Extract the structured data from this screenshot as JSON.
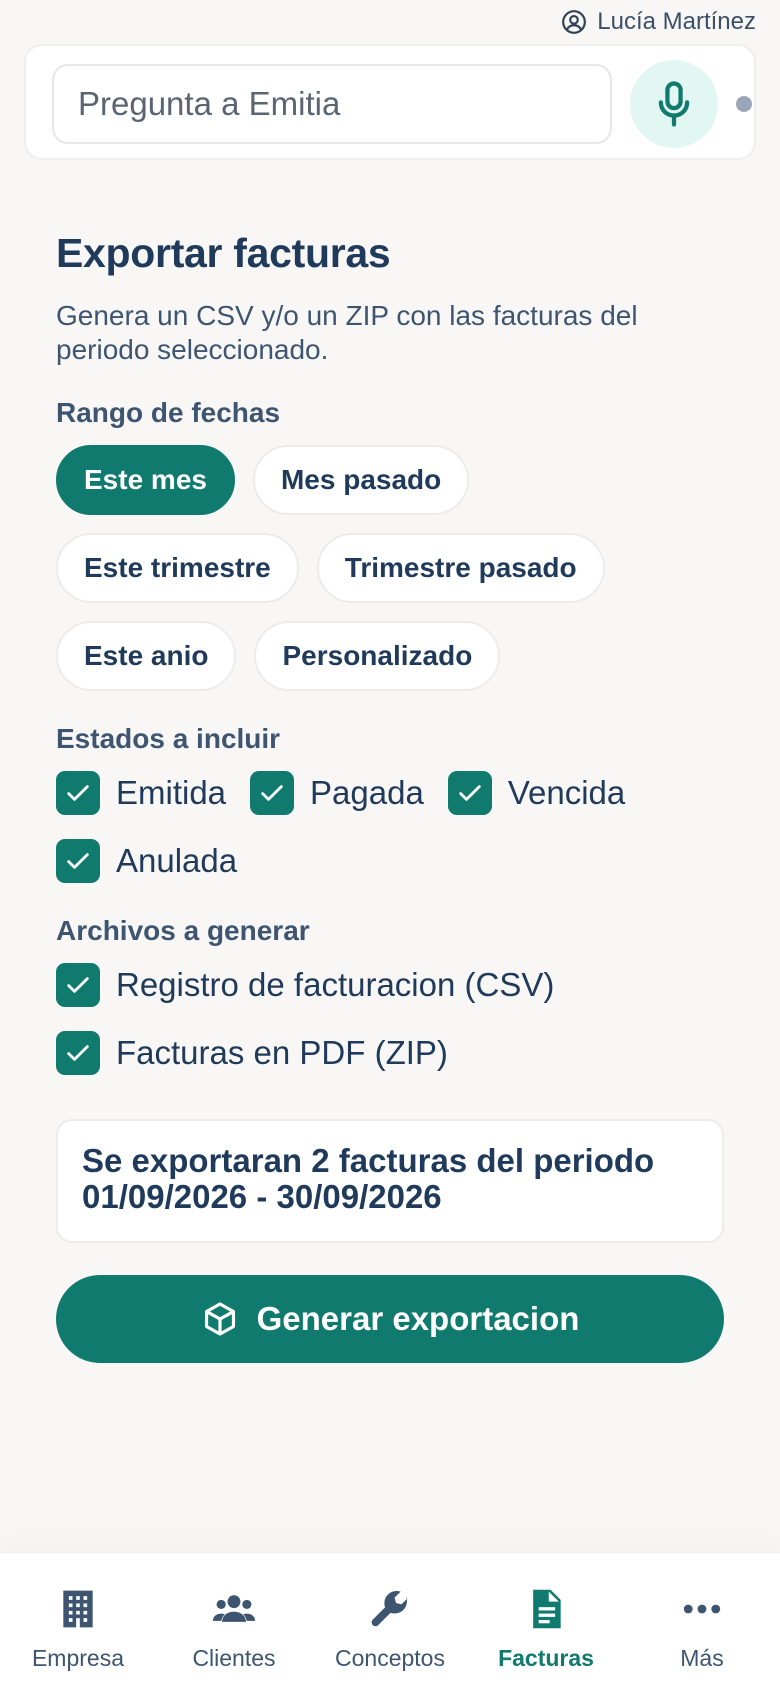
{
  "user": {
    "name": "Lucía Martínez",
    "icon": "user-circle-icon"
  },
  "ask": {
    "placeholder": "Pregunta a Emitia",
    "mic_icon": "microphone-icon"
  },
  "page": {
    "title": "Exportar facturas",
    "description": "Genera un CSV y/o un ZIP con las facturas del periodo seleccionado."
  },
  "date_range": {
    "label": "Rango de fechas",
    "options": [
      "Este mes",
      "Mes pasado",
      "Este trimestre",
      "Trimestre pasado",
      "Este anio",
      "Personalizado"
    ],
    "selected": "Este mes"
  },
  "states": {
    "label": "Estados a incluir",
    "items": [
      {
        "label": "Emitida",
        "checked": true
      },
      {
        "label": "Pagada",
        "checked": true
      },
      {
        "label": "Vencida",
        "checked": true
      },
      {
        "label": "Anulada",
        "checked": true
      }
    ]
  },
  "files": {
    "label": "Archivos a generar",
    "items": [
      {
        "label": "Registro de facturacion (CSV)",
        "checked": true
      },
      {
        "label": "Facturas en PDF (ZIP)",
        "checked": true
      }
    ]
  },
  "summary": {
    "line1": "Se exportaran 2 facturas del periodo",
    "line2": "01/09/2026 - 30/09/2026"
  },
  "generate_button": {
    "label": "Generar exportacion",
    "icon": "cube-icon"
  },
  "nav": {
    "items": [
      {
        "label": "Empresa",
        "icon": "building-icon"
      },
      {
        "label": "Clientes",
        "icon": "users-icon"
      },
      {
        "label": "Conceptos",
        "icon": "wrench-icon"
      },
      {
        "label": "Facturas",
        "icon": "document-icon"
      },
      {
        "label": "Más",
        "icon": "more-icon"
      }
    ],
    "active": "Facturas"
  },
  "colors": {
    "accent": "#117a6e",
    "text": "#1f3a5a",
    "background": "#f8f7f5"
  }
}
